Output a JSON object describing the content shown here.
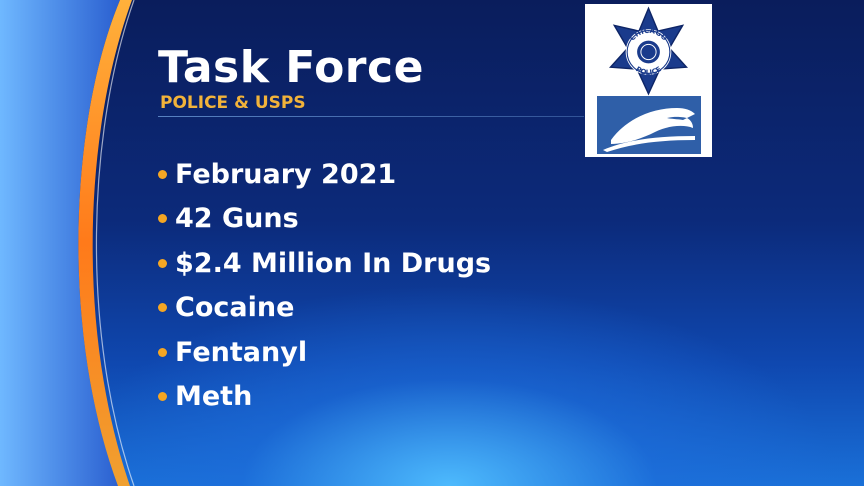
{
  "graphic": {
    "title": "Task Force",
    "subtitle": "POLICE & USPS",
    "bullets": [
      "February 2021",
      "42 Guns",
      "$2.4 Million In Drugs",
      "Cocaine",
      "Fentanyl",
      "Meth"
    ]
  },
  "logos": {
    "police_badge": {
      "icon": "chicago-police-star-icon",
      "text_top": "CHICAGO",
      "text_bottom": "POLICE"
    },
    "usps": {
      "icon": "usps-eagle-icon"
    }
  },
  "colors": {
    "background_dark": "#0a1d5c",
    "background_glow": "#50beff",
    "accent_orange": "#f5a623",
    "subtitle_gold": "#f2b33a",
    "text": "#ffffff",
    "police_blue": "#1a3b8c",
    "usps_blue": "#2f5fa8"
  }
}
